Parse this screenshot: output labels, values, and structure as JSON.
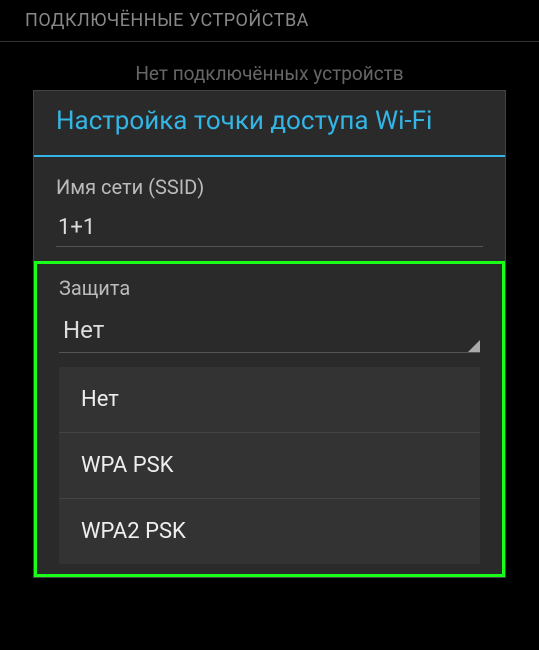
{
  "screen": {
    "header": "ПОДКЛЮЧЁННЫЕ УСТРОЙСТВА",
    "no_devices": "Нет подключённых устройств"
  },
  "dialog": {
    "title": "Настройка точки доступа Wi-Fi",
    "ssid_label": "Имя сети (SSID)",
    "ssid_value": "1+1",
    "security_label": "Защита",
    "security_value": "Нет",
    "security_options": {
      "0": "Нет",
      "1": "WPA PSK",
      "2": "WPA2 PSK"
    }
  }
}
